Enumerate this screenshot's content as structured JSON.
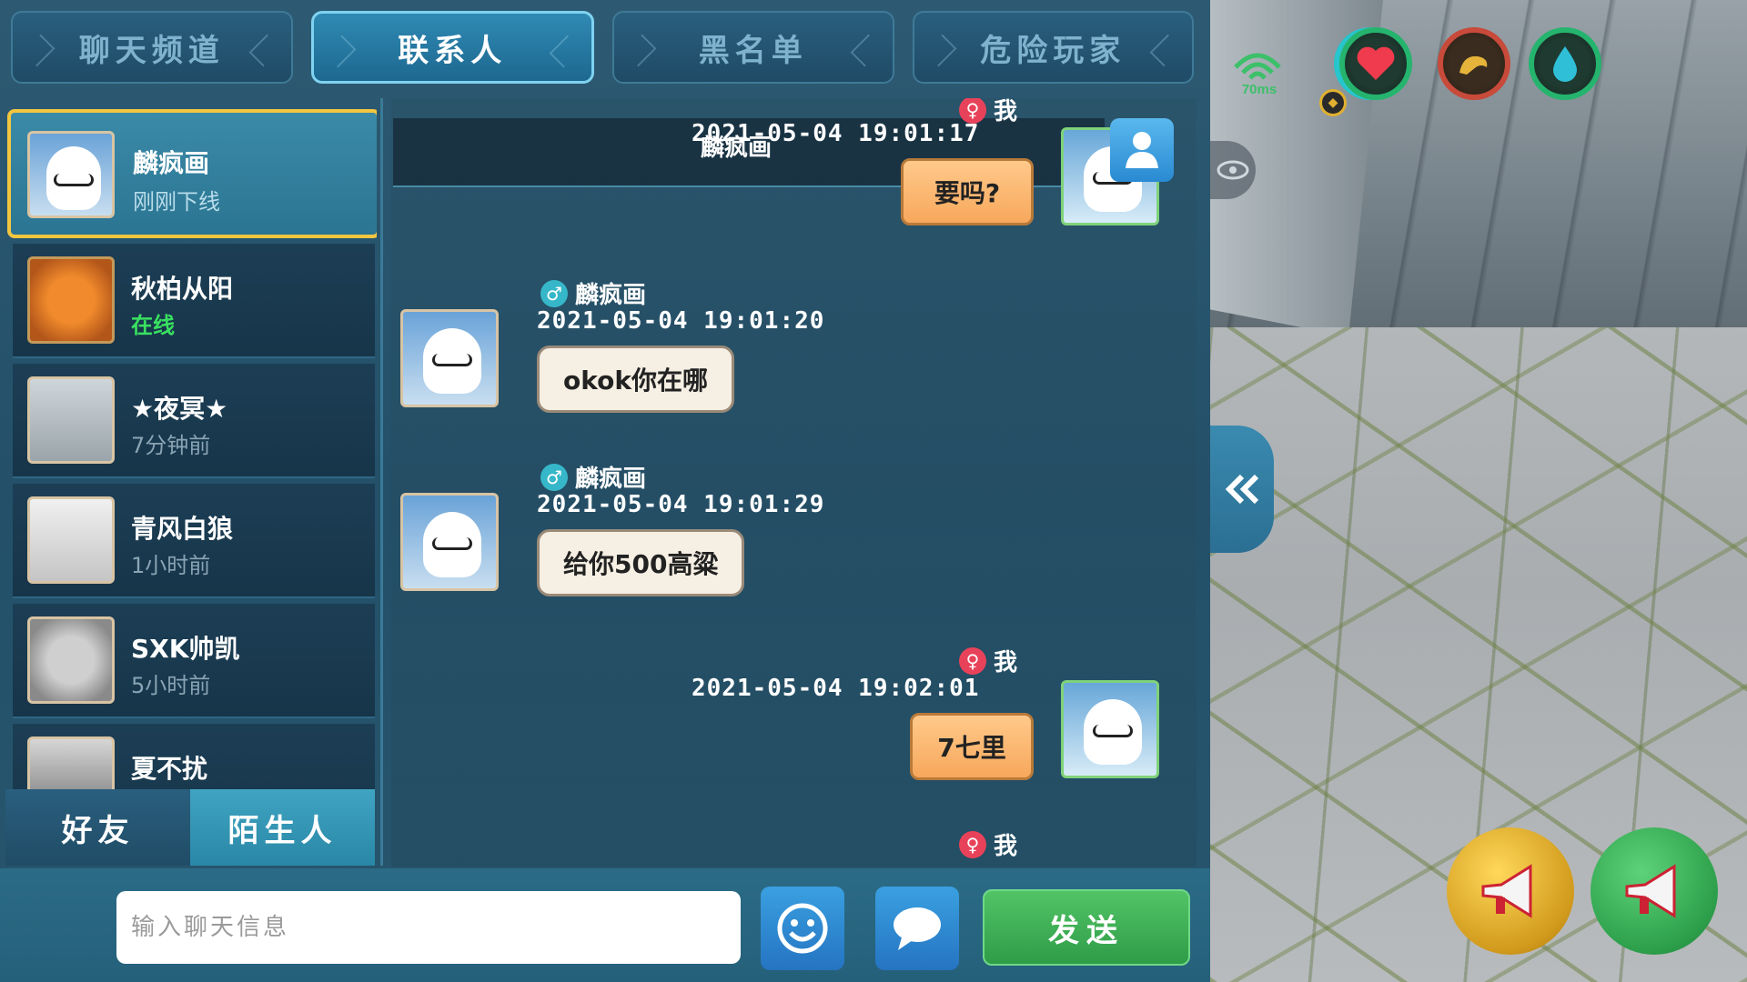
{
  "tabs": [
    {
      "label": "聊天频道"
    },
    {
      "label": "联系人"
    },
    {
      "label": "黑名单"
    },
    {
      "label": "危险玩家"
    }
  ],
  "active_tab": "联系人",
  "contacts": [
    {
      "name": "麟疯画",
      "status": "刚刚下线",
      "avatar": "ghost"
    },
    {
      "name": "秋柏从阳",
      "status": "在线",
      "avatar": "pumpkin"
    },
    {
      "name": "★夜冥★",
      "status": "7分钟前",
      "avatar": "fish"
    },
    {
      "name": "青风白狼",
      "status": "1小时前",
      "avatar": "person"
    },
    {
      "name": "SXK帅凯",
      "status": "5小时前",
      "avatar": "gray-pumpkin"
    },
    {
      "name": "夏不扰",
      "status": "",
      "avatar": "dark"
    }
  ],
  "list_tabs": {
    "friends": "好友",
    "strangers": "陌生人"
  },
  "messages": [
    {
      "sender": "我",
      "gender": "female",
      "time": "2021-05-04   19:01:17",
      "text": "要吗?",
      "mine": true
    },
    {
      "sender": "麟疯画",
      "gender": "male",
      "time": "2021-05-04   19:01:20",
      "text": "okok你在哪",
      "mine": false
    },
    {
      "sender": "麟疯画",
      "gender": "male",
      "time": "2021-05-04   19:01:29",
      "text": "给你500高粱",
      "mine": false
    },
    {
      "sender": "我",
      "gender": "female",
      "time": "2021-05-04   19:02:01",
      "text": "7七里",
      "mine": true
    },
    {
      "sender": "我",
      "gender": "female",
      "time": "",
      "text": "",
      "mine": true
    }
  ],
  "notice_overlay": "麟疯画",
  "input": {
    "placeholder": "输入聊天信息",
    "value": ""
  },
  "buttons": {
    "send": "发送"
  },
  "hud": {
    "ping": "70ms"
  },
  "icons": {
    "tab_arrows": "chevron-icon",
    "emoji": "smiley-icon",
    "message": "speech-bubble-icon",
    "profile": "person-icon",
    "collapse": "double-chevron-left-icon",
    "eye": "eye-icon",
    "heart": "heart-icon",
    "stamina": "arm-icon",
    "water": "water-drop-icon",
    "horn_gold": "megaphone-icon",
    "horn_green": "megaphone-icon"
  },
  "colors": {
    "panel_bg": "#24506a",
    "selected_border": "#f3c640",
    "online": "#39e060",
    "send_button": "#2f9c48",
    "out_bubble": "#f7a85c",
    "in_bubble": "#f6efe3"
  }
}
